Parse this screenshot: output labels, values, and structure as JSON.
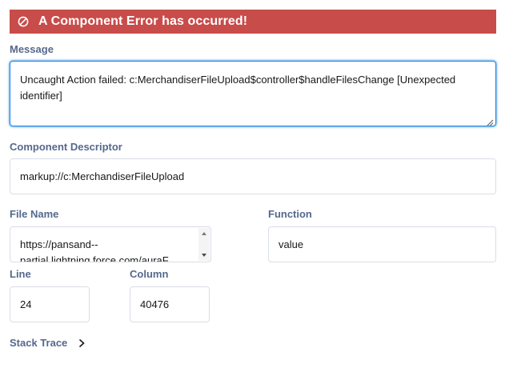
{
  "banner": {
    "title": "A Component Error has occurred!",
    "icon": "ban-icon",
    "color": "#c84c4a"
  },
  "message": {
    "label": "Message",
    "value": "Uncaught Action failed: c:MerchandiserFileUpload$controller$handleFilesChange [Unexpected identifier]"
  },
  "descriptor": {
    "label": "Component Descriptor",
    "value": "markup://c:MerchandiserFileUpload"
  },
  "file_name": {
    "label": "File Name",
    "value": "https://pansand--\npartial.lightning.force.com/auraF"
  },
  "function": {
    "label": "Function",
    "value": "value"
  },
  "line": {
    "label": "Line",
    "value": "24"
  },
  "column": {
    "label": "Column",
    "value": "40476"
  },
  "stack_trace": {
    "label": "Stack Trace",
    "icon": "chevron-right-icon"
  },
  "colors": {
    "label": "#54698d",
    "focus": "#1589ee",
    "border": "#d8dde6"
  }
}
